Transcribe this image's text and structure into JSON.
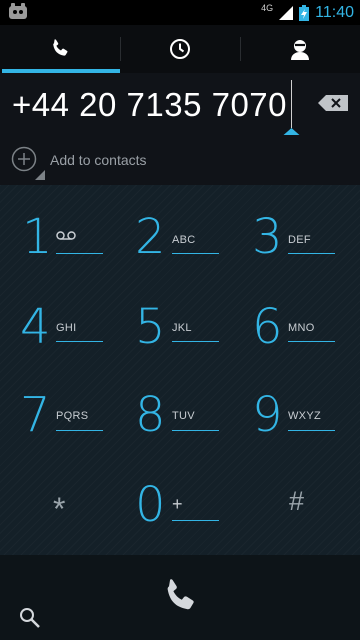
{
  "status": {
    "network": "4G",
    "time": "11:40"
  },
  "tabs": [
    {
      "name": "dialpad",
      "icon": "phone-icon",
      "active": true
    },
    {
      "name": "call-log",
      "icon": "clock-icon",
      "active": false
    },
    {
      "name": "contacts",
      "icon": "person-icon",
      "active": false
    }
  ],
  "dialer": {
    "number": "+44 20 7135 7070",
    "add_to_contacts": "Add to contacts"
  },
  "keys": [
    {
      "digit": "1",
      "letters": ""
    },
    {
      "digit": "2",
      "letters": "ABC"
    },
    {
      "digit": "3",
      "letters": "DEF"
    },
    {
      "digit": "4",
      "letters": "GHI"
    },
    {
      "digit": "5",
      "letters": "JKL"
    },
    {
      "digit": "6",
      "letters": "MNO"
    },
    {
      "digit": "7",
      "letters": "PQRS"
    },
    {
      "digit": "8",
      "letters": "TUV"
    },
    {
      "digit": "9",
      "letters": "WXYZ"
    },
    {
      "digit": "*",
      "letters": ""
    },
    {
      "digit": "0",
      "letters": "+"
    },
    {
      "digit": "#",
      "letters": ""
    }
  ],
  "colors": {
    "accent": "#33b5e5",
    "background": "#142028"
  }
}
